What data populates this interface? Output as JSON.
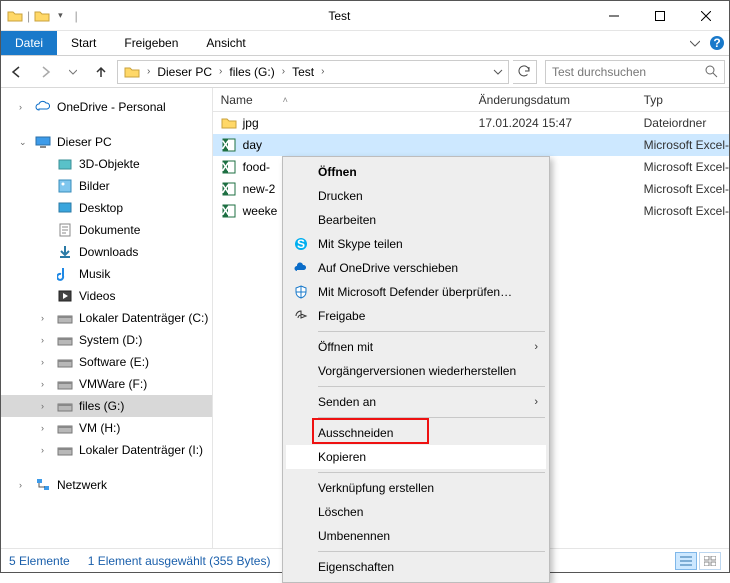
{
  "window": {
    "title": "Test"
  },
  "ribbon": {
    "tabs": {
      "file": "Datei",
      "home": "Start",
      "share": "Freigeben",
      "view": "Ansicht"
    }
  },
  "breadcrumbs": [
    "Dieser PC",
    "files (G:)",
    "Test"
  ],
  "search": {
    "placeholder": "Test durchsuchen"
  },
  "tree": {
    "onedrive": "OneDrive - Personal",
    "thispc": "Dieser PC",
    "children": [
      "3D-Objekte",
      "Bilder",
      "Desktop",
      "Dokumente",
      "Downloads",
      "Musik",
      "Videos",
      "Lokaler Datenträger (C:)",
      "System (D:)",
      "Software (E:)",
      "VMWare (F:)",
      "files (G:)",
      "VM (H:)",
      "Lokaler Datenträger (I:)"
    ],
    "network": "Netzwerk",
    "selected_index": 11
  },
  "columns": {
    "name": "Name",
    "date": "Änderungsdatum",
    "type": "Typ"
  },
  "rows": [
    {
      "icon": "folder",
      "name": "jpg",
      "date": "17.01.2024 15:47",
      "type": "Dateiordner"
    },
    {
      "icon": "excel",
      "name": "day",
      "date": "",
      "type": "Microsoft Excel-",
      "selected": true
    },
    {
      "icon": "excel",
      "name": "food-",
      "date": "",
      "type": "Microsoft Excel-"
    },
    {
      "icon": "excel",
      "name": "new-2",
      "date": "",
      "type": "Microsoft Excel-"
    },
    {
      "icon": "excel",
      "name": "weeke",
      "date": "",
      "type": "Microsoft Excel-"
    }
  ],
  "context_menu": {
    "open": "Öffnen",
    "print": "Drucken",
    "edit": "Bearbeiten",
    "skype": "Mit Skype teilen",
    "onedrive": "Auf OneDrive verschieben",
    "defender": "Mit Microsoft Defender überprüfen…",
    "share": "Freigabe",
    "openwith": "Öffnen mit",
    "prev": "Vorgängerversionen wiederherstellen",
    "sendto": "Senden an",
    "cut": "Ausschneiden",
    "copy": "Kopieren",
    "shortcut": "Verknüpfung erstellen",
    "delete": "Löschen",
    "rename": "Umbenennen",
    "props": "Eigenschaften"
  },
  "status": {
    "count": "5 Elemente",
    "selection": "1 Element ausgewählt (355 Bytes)"
  }
}
